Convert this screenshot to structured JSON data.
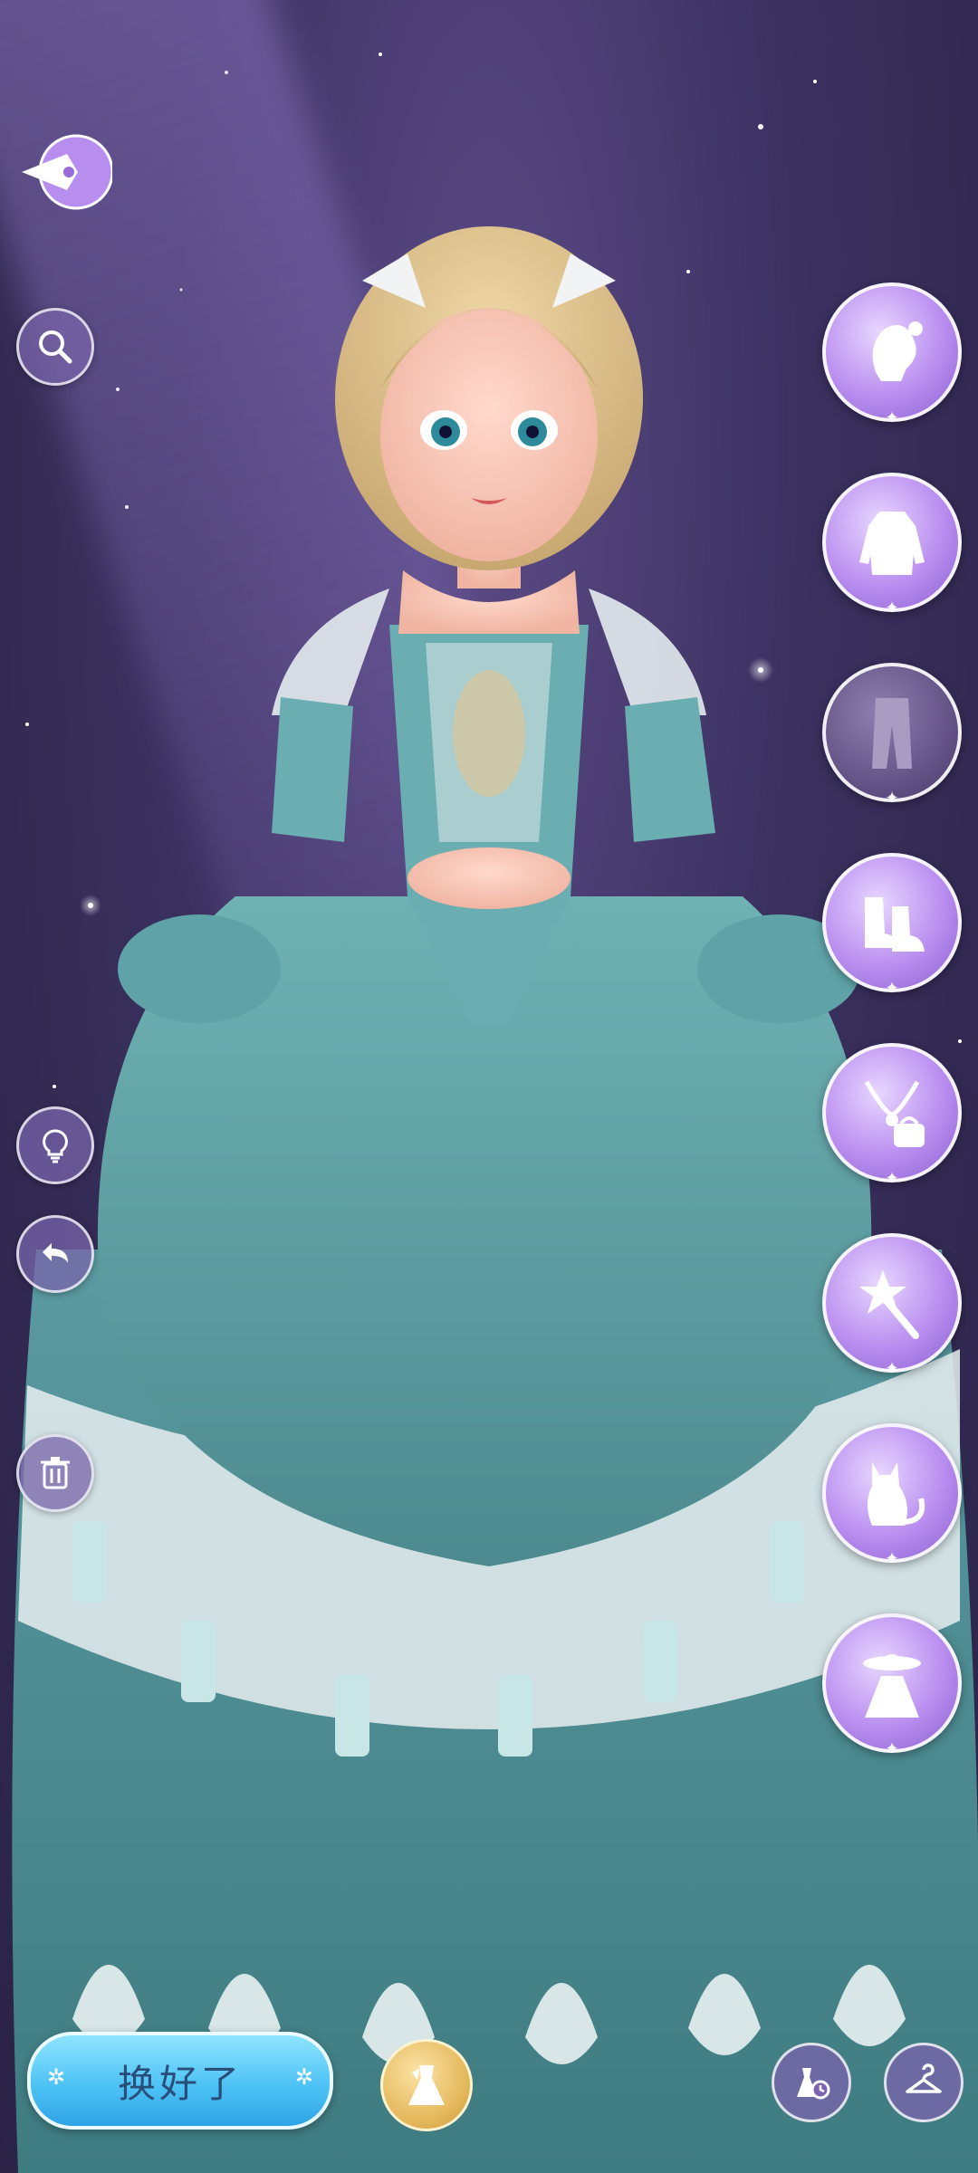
{
  "colors": {
    "bg_dark": "#2a2346",
    "bg_mid": "#3b3160",
    "category_purple": "#b98ef0",
    "done_button_blue": "#4ec3f5",
    "dress_teal": "#5f9da0"
  },
  "left_tools": [
    "pen-back-icon",
    "search-icon",
    "lightbulb-icon",
    "undo-icon",
    "trash-icon"
  ],
  "categories": [
    {
      "name": "hairstyle-icon",
      "active": false
    },
    {
      "name": "top-icon",
      "active": false
    },
    {
      "name": "pants-icon",
      "active": true
    },
    {
      "name": "shoes-icon",
      "active": false
    },
    {
      "name": "accessories-icon",
      "active": false
    },
    {
      "name": "magic-wand-icon",
      "active": false
    },
    {
      "name": "cat-pet-icon",
      "active": false
    },
    {
      "name": "hat-dress-icon",
      "active": false
    }
  ],
  "bottom": {
    "done_label": "换好了",
    "done_star_left": "✲",
    "done_star_right": "✲"
  }
}
